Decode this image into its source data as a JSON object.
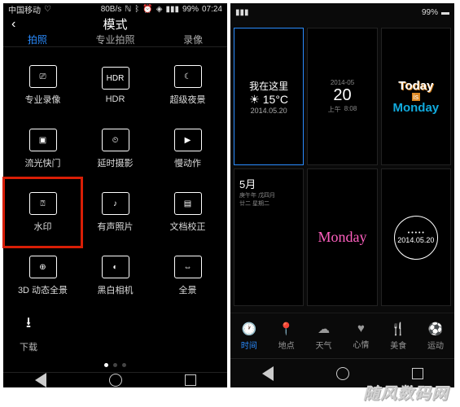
{
  "status": {
    "carrier": "中国移动",
    "speed": "80B/s",
    "battery": "99%",
    "time": "07:24"
  },
  "left": {
    "title": "模式",
    "tabs": [
      "拍照",
      "专业拍照",
      "录像"
    ],
    "active_tab": 0,
    "modes": [
      {
        "label": "专业录像",
        "glyph": "⎚"
      },
      {
        "label": "HDR",
        "glyph": "HDR"
      },
      {
        "label": "超级夜景",
        "glyph": "☾"
      },
      {
        "label": "流光快门",
        "glyph": "▣"
      },
      {
        "label": "延时摄影",
        "glyph": "⏲"
      },
      {
        "label": "慢动作",
        "glyph": "▶"
      },
      {
        "label": "水印",
        "glyph": "⍰",
        "highlight": true
      },
      {
        "label": "有声照片",
        "glyph": "♪"
      },
      {
        "label": "文档校正",
        "glyph": "▤"
      },
      {
        "label": "3D 动态全景",
        "glyph": "⊕"
      },
      {
        "label": "黑白相机",
        "glyph": "◐"
      },
      {
        "label": "全景",
        "glyph": "⇔"
      }
    ],
    "download": "下载"
  },
  "right": {
    "watermarks": [
      {
        "kind": "here",
        "line1": "我在这里",
        "line2": "15°C",
        "line3": "2014.05.20",
        "weather_glyph": "☀"
      },
      {
        "kind": "bignum",
        "line1": "2014-05",
        "line2": "20",
        "line3": "上午",
        "line4": "8:08"
      },
      {
        "kind": "todayis",
        "today": "Today",
        "is": "is",
        "day": "Monday"
      },
      {
        "kind": "month",
        "line1": "5月",
        "line2": "庚午年 戊四月",
        "line3": "廿二 星期二"
      },
      {
        "kind": "script",
        "day": "Monday"
      },
      {
        "kind": "stamp",
        "date": "2014.05.20"
      }
    ],
    "bottom_tabs": [
      {
        "icon": "🕐",
        "label": "时间",
        "active": true
      },
      {
        "icon": "📍",
        "label": "地点"
      },
      {
        "icon": "☁",
        "label": "天气"
      },
      {
        "icon": "♥",
        "label": "心情"
      },
      {
        "icon": "🍴",
        "label": "美食"
      },
      {
        "icon": "⚽",
        "label": "运动"
      }
    ]
  },
  "site_mark": "随风数码网"
}
